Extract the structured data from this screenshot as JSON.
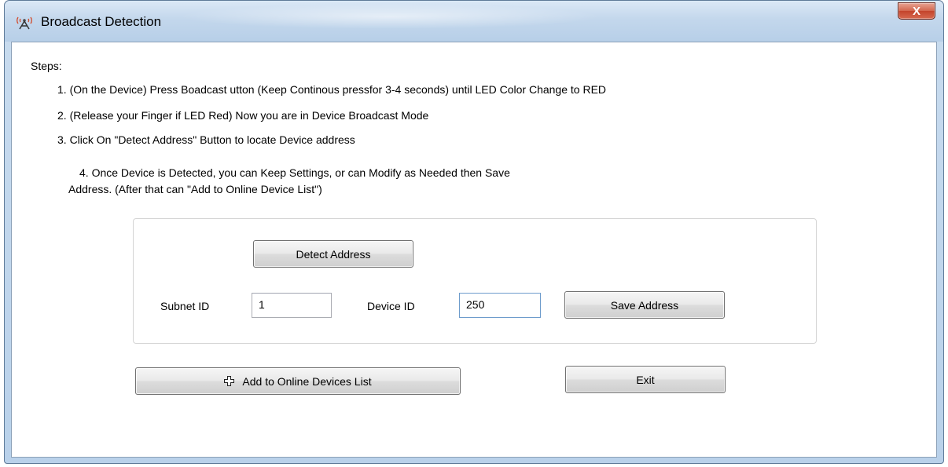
{
  "window": {
    "title": "Broadcast Detection",
    "close_glyph": "X"
  },
  "steps": {
    "label": "Steps:",
    "step1": "1. (On the Device) Press Boadcast utton (Keep Continous pressfor 3-4 seconds) until LED Color Change to RED",
    "step2": "2. (Release your Finger if LED Red) Now you are in Device Broadcast Mode",
    "step3": "3. Click On \"Detect Address\" Button to locate Device address",
    "step4_line1": "4. Once Device is Detected, you can Keep Settings, or can Modify as Needed then Save",
    "step4_line2": "Address. (After that can \"Add to Online Device List\")"
  },
  "address_group": {
    "detect_button": "Detect Address",
    "subnet_label": "Subnet ID",
    "subnet_value": "1",
    "device_label": "Device ID",
    "device_value": "250",
    "save_button": "Save Address"
  },
  "actions": {
    "add_button": "Add to Online Devices List",
    "exit_button": "Exit"
  },
  "icons": {
    "title": "broadcast-icon",
    "close": "close-icon",
    "add": "plus-icon"
  },
  "colors": {
    "close_button": "#c4442c",
    "title_bar": "#c3d7ec"
  }
}
